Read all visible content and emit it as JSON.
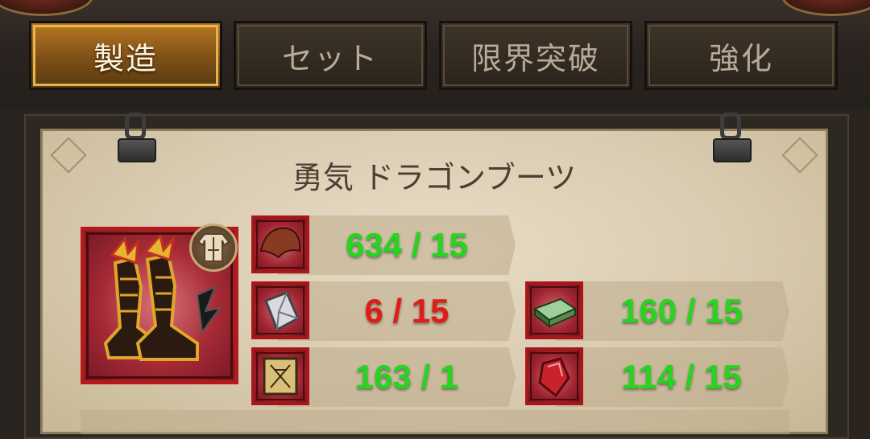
{
  "tabs": [
    {
      "label": "製造",
      "active": true
    },
    {
      "label": "セット",
      "active": false
    },
    {
      "label": "限界突破",
      "active": false
    },
    {
      "label": "強化",
      "active": false
    }
  ],
  "item": {
    "name": "勇気 ドラゴンブーツ",
    "icon": "dragon-boots-icon",
    "class_icon": "armor-class-icon"
  },
  "materials": [
    {
      "icon": "leather-hide-icon",
      "have": 634,
      "need": 15,
      "text": "634 / 15",
      "sufficient": true
    },
    {
      "icon": "crystal-shard-icon",
      "have": 6,
      "need": 15,
      "text": "6 / 15",
      "sufficient": false
    },
    {
      "icon": "blueprint-scroll-icon",
      "have": 163,
      "need": 1,
      "text": "163 / 1",
      "sufficient": true
    },
    {
      "icon": "green-ingot-icon",
      "have": 160,
      "need": 15,
      "text": "160 / 15",
      "sufficient": true
    },
    {
      "icon": "red-gem-icon",
      "have": 114,
      "need": 15,
      "text": "114 / 15",
      "sufficient": true
    }
  ],
  "colors": {
    "sufficient": "#27d41f",
    "insufficient": "#e01b18",
    "accent": "#c88a2a",
    "frame_red": "#b4191b"
  }
}
